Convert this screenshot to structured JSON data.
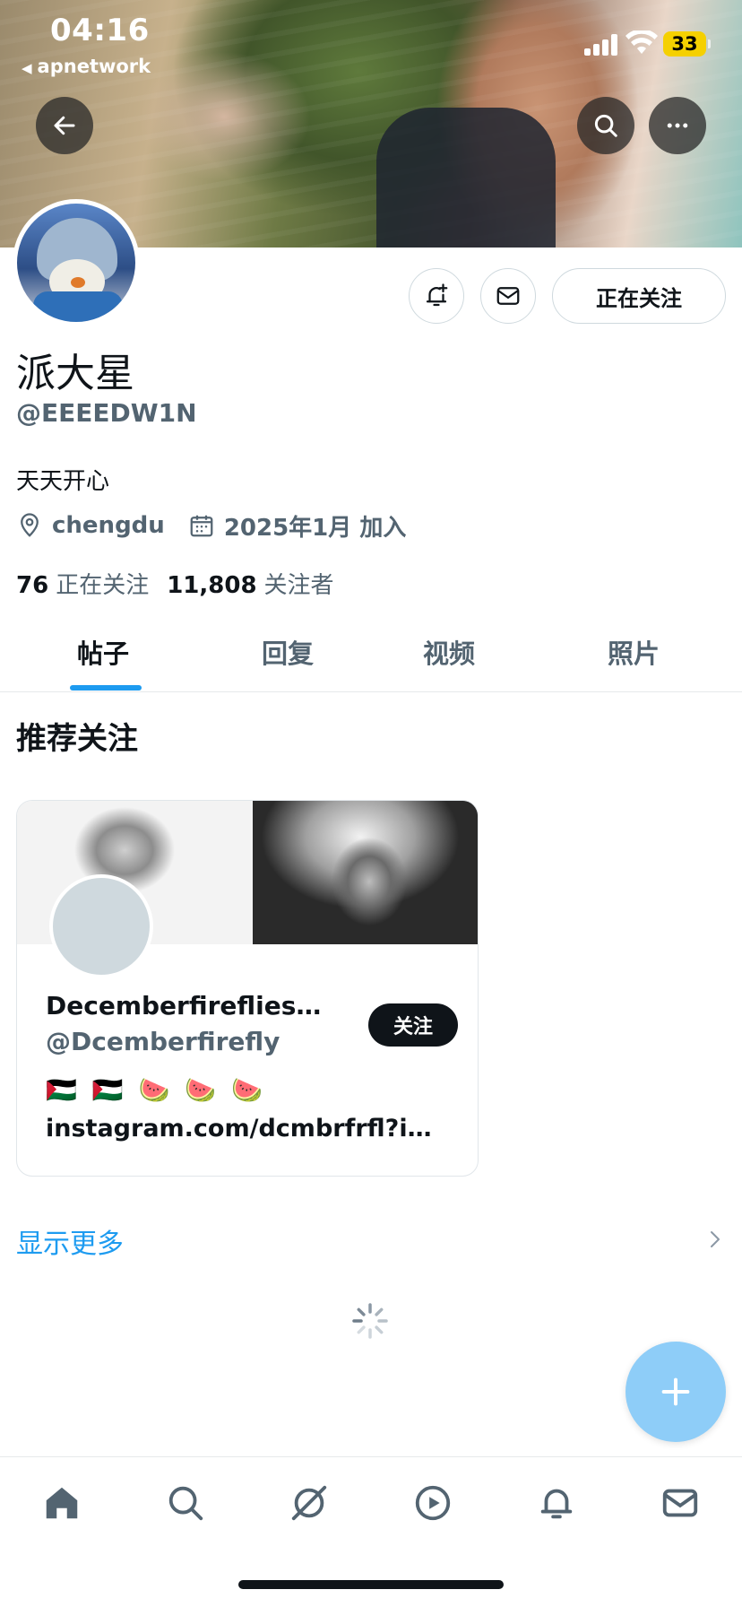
{
  "status_bar": {
    "time": "04:16",
    "back_app": "apnetwork",
    "battery": "33"
  },
  "header": {
    "back_icon": "arrow-left-icon",
    "search_icon": "search-icon",
    "more_icon": "more-horizontal-icon"
  },
  "profile": {
    "name": "派大星",
    "handle": "@EEEEDW1N",
    "bio": "天天开心",
    "location": "chengdu",
    "joined": "2025年1月 加入",
    "following_count": "76",
    "following_label": "正在关注",
    "followers_count": "11,808",
    "followers_label": "关注者",
    "following_button": "正在关注"
  },
  "tabs": [
    {
      "label": "帖子",
      "active": true
    },
    {
      "label": "回复",
      "active": false
    },
    {
      "label": "视频",
      "active": false
    },
    {
      "label": "照片",
      "active": false
    }
  ],
  "recommend": {
    "title": "推荐关注",
    "card": {
      "name": "Decemberfireflies…",
      "handle": "@Dcemberfirefly",
      "follow_label": "关注",
      "emoji": "🇵🇸 🇵🇸 🍉 🍉 🍉",
      "link": "instagram.com/dcmbrfrfl?i…"
    },
    "show_more": "显示更多"
  },
  "bottom_nav": [
    "home-icon",
    "search-icon",
    "grok-icon",
    "video-icon",
    "notifications-icon",
    "messages-icon"
  ],
  "colors": {
    "accent": "#1d9bf0",
    "fab": "#8ecdf8",
    "text_primary": "#0f1419",
    "text_secondary": "#536471",
    "battery": "#f5d000"
  }
}
